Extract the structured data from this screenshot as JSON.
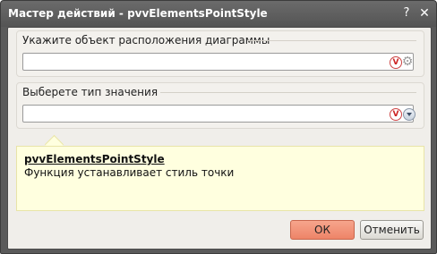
{
  "window": {
    "title": "Мастер действий - pvvElementsPointStyle",
    "help_symbol": "?",
    "close_symbol": "✕"
  },
  "groups": [
    {
      "legend": "Укажите объект расположения диаграммы",
      "value": "",
      "icons": [
        "variable-icon",
        "gear-icon"
      ]
    },
    {
      "legend": "Выберете тип значения",
      "value": "",
      "icons": [
        "variable-icon",
        "dropdown-icon"
      ]
    }
  ],
  "icon_glyphs": {
    "variable": "V",
    "gear": "⚙"
  },
  "description": {
    "title": "pvvElementsPointStyle",
    "text": "Функция устанавливает стиль точки"
  },
  "buttons": {
    "ok": "ОК",
    "cancel": "Отменить"
  },
  "colors": {
    "titlebar": "#5f5f5f",
    "description_bg": "#ffffdf",
    "ok_button": "#f19478"
  }
}
